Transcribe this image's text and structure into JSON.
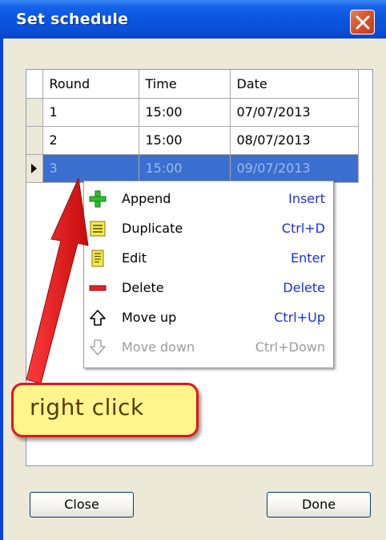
{
  "window": {
    "title": "Set schedule"
  },
  "grid": {
    "columns": [
      "Round",
      "Time",
      "Date"
    ],
    "rows": [
      {
        "round": "1",
        "time": "15:00",
        "date": "07/07/2013"
      },
      {
        "round": "2",
        "time": "15:00",
        "date": "08/07/2013"
      },
      {
        "round": "3",
        "time": "15:00",
        "date": "09/07/2013",
        "selected": true
      }
    ]
  },
  "context_menu": {
    "items": [
      {
        "label": "Append",
        "shortcut": "Insert",
        "icon": "plus-icon"
      },
      {
        "label": "Duplicate",
        "shortcut": "Ctrl+D",
        "icon": "duplicate-icon"
      },
      {
        "label": "Edit",
        "shortcut": "Enter",
        "icon": "edit-icon"
      },
      {
        "label": "Delete",
        "shortcut": "Delete",
        "icon": "minus-icon"
      },
      {
        "label": "Move up",
        "shortcut": "Ctrl+Up",
        "icon": "arrow-up-icon"
      },
      {
        "label": "Move down",
        "shortcut": "Ctrl+Down",
        "icon": "arrow-down-icon",
        "disabled": true
      }
    ]
  },
  "annotation": {
    "text": "right click"
  },
  "buttons": {
    "close": "Close",
    "done": "Done"
  },
  "colors": {
    "title_bar": "#0a55e0",
    "selection": "#3a6fcf",
    "shortcut": "#1c2ee0",
    "callout_fill": "#fff58c",
    "callout_border": "#e3161c"
  }
}
